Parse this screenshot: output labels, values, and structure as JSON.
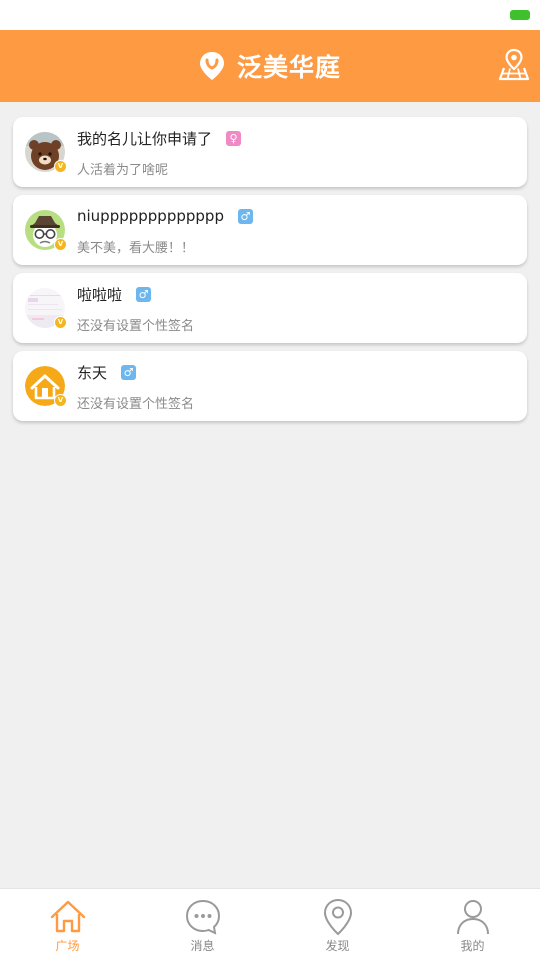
{
  "header": {
    "title": "泛美华庭",
    "logo_icon": "location-pin-icon",
    "map_icon": "map-location-icon",
    "accent_color": "#fe9a41"
  },
  "users": [
    {
      "name": "我的名儿让你申请了",
      "gender": "♀",
      "gender_type": "female",
      "signature": "人活着为了啥呢",
      "avatar": "bear-avatar"
    },
    {
      "name": "niuppppppppppppp",
      "gender": "♂",
      "gender_type": "male",
      "signature": "美不美，看大腰！！",
      "avatar": "cartoon-glasses-avatar"
    },
    {
      "name": "啦啦啦",
      "gender": "♂",
      "gender_type": "male",
      "signature": "还没有设置个性签名",
      "avatar": "screenshot-avatar"
    },
    {
      "name": "东天",
      "gender": "♂",
      "gender_type": "male",
      "signature": "还没有设置个性签名",
      "avatar": "house-avatar"
    }
  ],
  "tabs": [
    {
      "label": "广场",
      "icon": "home-icon",
      "active": true
    },
    {
      "label": "消息",
      "icon": "chat-bubble-icon",
      "active": false
    },
    {
      "label": "发现",
      "icon": "location-pin-icon",
      "active": false
    },
    {
      "label": "我的",
      "icon": "user-icon",
      "active": false
    }
  ]
}
